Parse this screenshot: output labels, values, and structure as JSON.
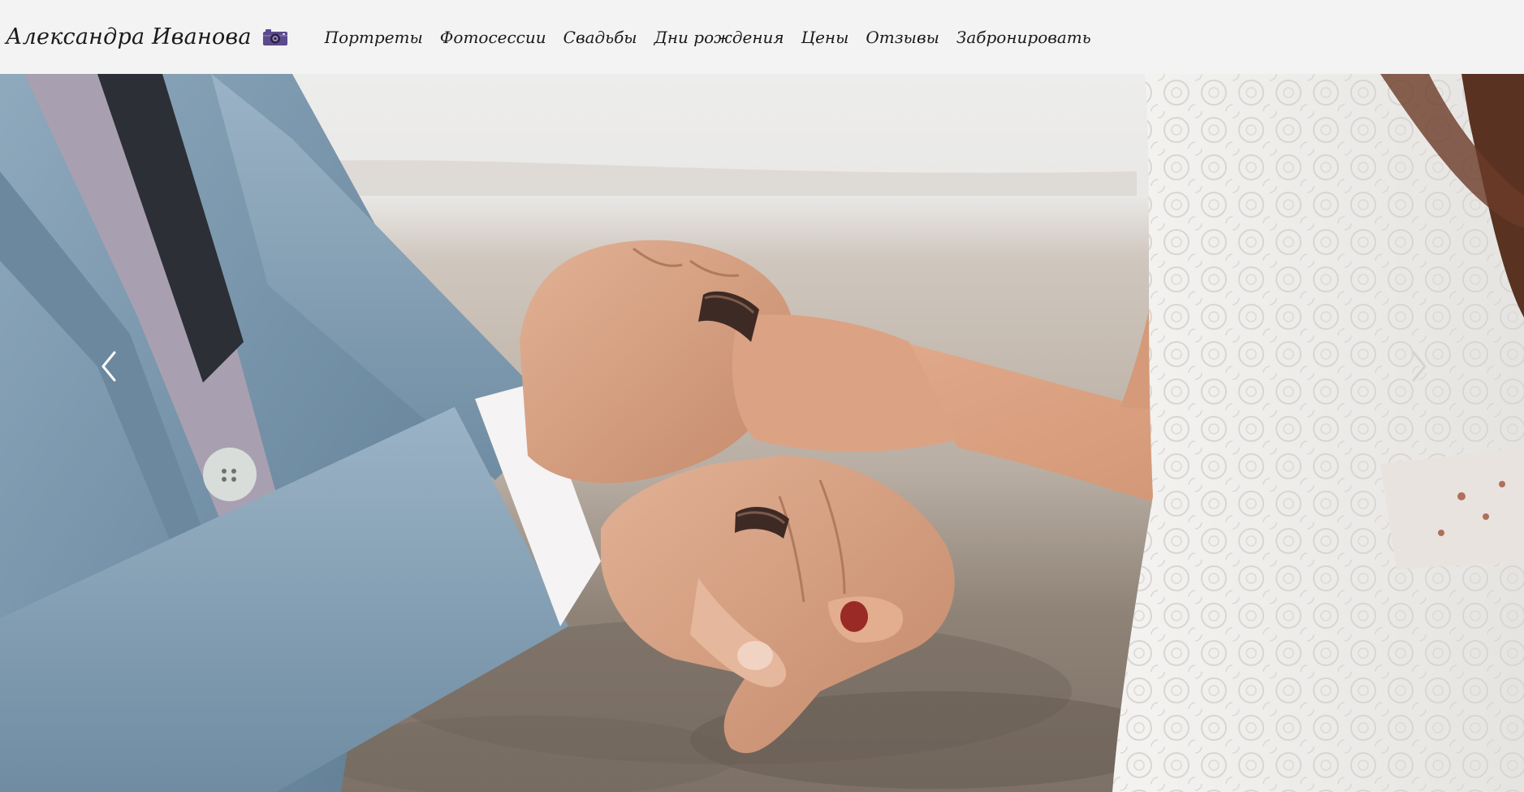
{
  "brand": {
    "name": "Александра Иванова",
    "icon": "camera-icon",
    "icon_color": "#5b4a8c"
  },
  "nav": {
    "items": [
      {
        "label": "Портреты"
      },
      {
        "label": "Фотосессии"
      },
      {
        "label": "Свадьбы"
      },
      {
        "label": "Дни рождения"
      },
      {
        "label": "Цены"
      },
      {
        "label": "Отзывы"
      },
      {
        "label": "Забронировать"
      }
    ]
  },
  "carousel": {
    "prev_icon": "chevron-left-icon",
    "next_icon": "chevron-right-icon"
  },
  "colors": {
    "navbar_bg": "#f3f3f3",
    "text": "#1a1a1a",
    "accent": "#5b4a8c"
  }
}
